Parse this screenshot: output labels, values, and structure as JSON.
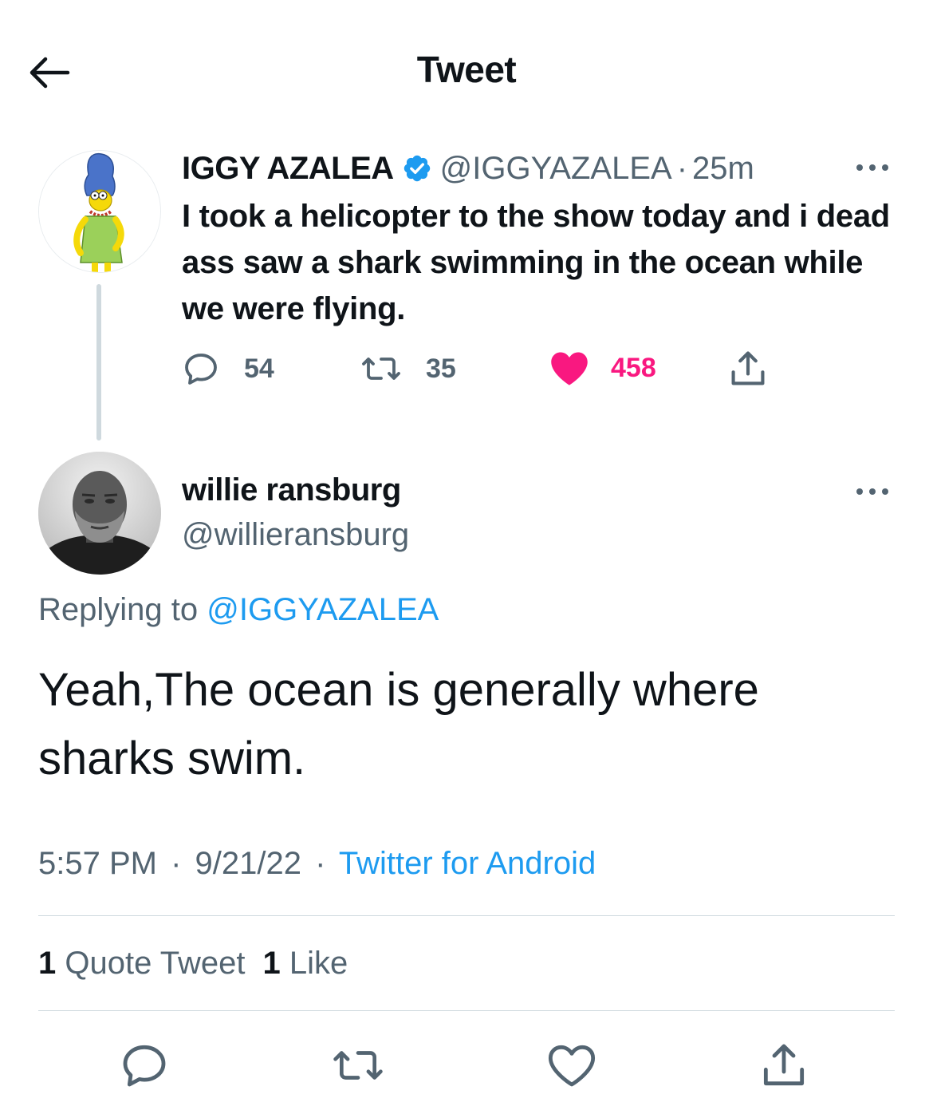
{
  "header": {
    "title": "Tweet"
  },
  "parent_tweet": {
    "name": "IGGY AZALEA",
    "handle": "@IGGYAZALEA",
    "separator": "·",
    "time": "25m",
    "text": "I took a helicopter to the show today and i dead ass saw a shark swimming in the ocean while we were flying.",
    "replies": "54",
    "retweets": "35",
    "likes": "458"
  },
  "reply_tweet": {
    "name": "willie ransburg",
    "handle": "@willieransburg",
    "replying_prefix": "Replying to",
    "replying_to": "@IGGYAZALEA",
    "text": "Yeah,The ocean is generally where sharks swim.",
    "time": "5:57 PM",
    "separator": "·",
    "date": "9/21/22",
    "source": "Twitter for Android",
    "quote_count": "1",
    "quote_label": "Quote Tweet",
    "like_count": "1",
    "like_label": "Like"
  },
  "colors": {
    "text_primary": "#0f1419",
    "text_secondary": "#536471",
    "link": "#1d9bf0",
    "like": "#f91880",
    "divider": "#cfd9de"
  },
  "icons": {
    "back": "arrow-left-icon",
    "verified": "verified-badge-icon",
    "more": "more-horizontal-icon",
    "reply": "reply-bubble-icon",
    "retweet": "retweet-icon",
    "like_filled": "heart-filled-icon",
    "like_outline": "heart-outline-icon",
    "share": "share-icon"
  }
}
